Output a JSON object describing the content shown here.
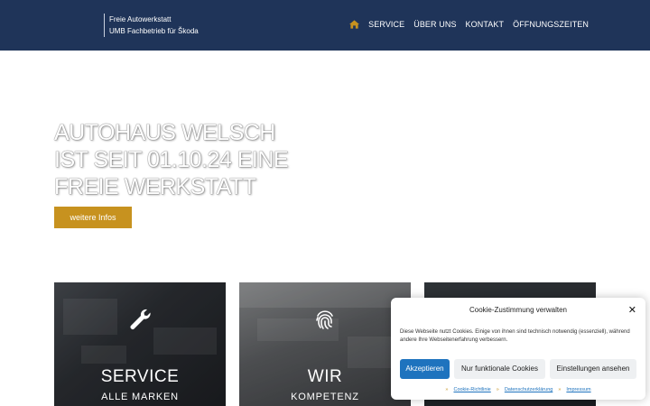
{
  "header": {
    "brand_line1": "Freie Autowerkstatt",
    "brand_line2": "UMB Fachbetrieb für Škoda",
    "nav": [
      "SERVICE",
      "ÜBER UNS",
      "KONTAKT",
      "ÖFFNUNGSZEITEN"
    ],
    "home_icon": "home-icon"
  },
  "hero": {
    "title_line1": "AUTOHAUS WELSCH",
    "title_line2": "IST SEIT 01.10.24 EINE",
    "title_line3": "FREIE WERKSTATT",
    "button": "weitere Infos"
  },
  "tiles": [
    {
      "title": "SERVICE",
      "subtitle": "ALLE MARKEN",
      "icon": "wrench-icon"
    },
    {
      "title": "WIR",
      "subtitle": "KOMPETENZ",
      "icon": "fingerprint-icon"
    },
    {
      "title": "",
      "subtitle": "",
      "icon": ""
    }
  ],
  "cookie": {
    "title": "Cookie-Zustimmung verwalten",
    "text": "Diese Webseite nutzt Cookies. Einige von ihnen sind technisch notwendig (essenziell), während andere Ihre Webseitenerfahrung verbessern.",
    "accept": "Akzeptieren",
    "functional": "Nur funktionale Cookies",
    "settings": "Einstellungen ansehen",
    "links": [
      "Cookie-Richtlinie",
      "Datenschutzerklärung",
      "Impressum"
    ]
  },
  "colors": {
    "header_bg": "#1f3459",
    "accent": "#c7921f",
    "cookie_primary": "#1e73be"
  }
}
